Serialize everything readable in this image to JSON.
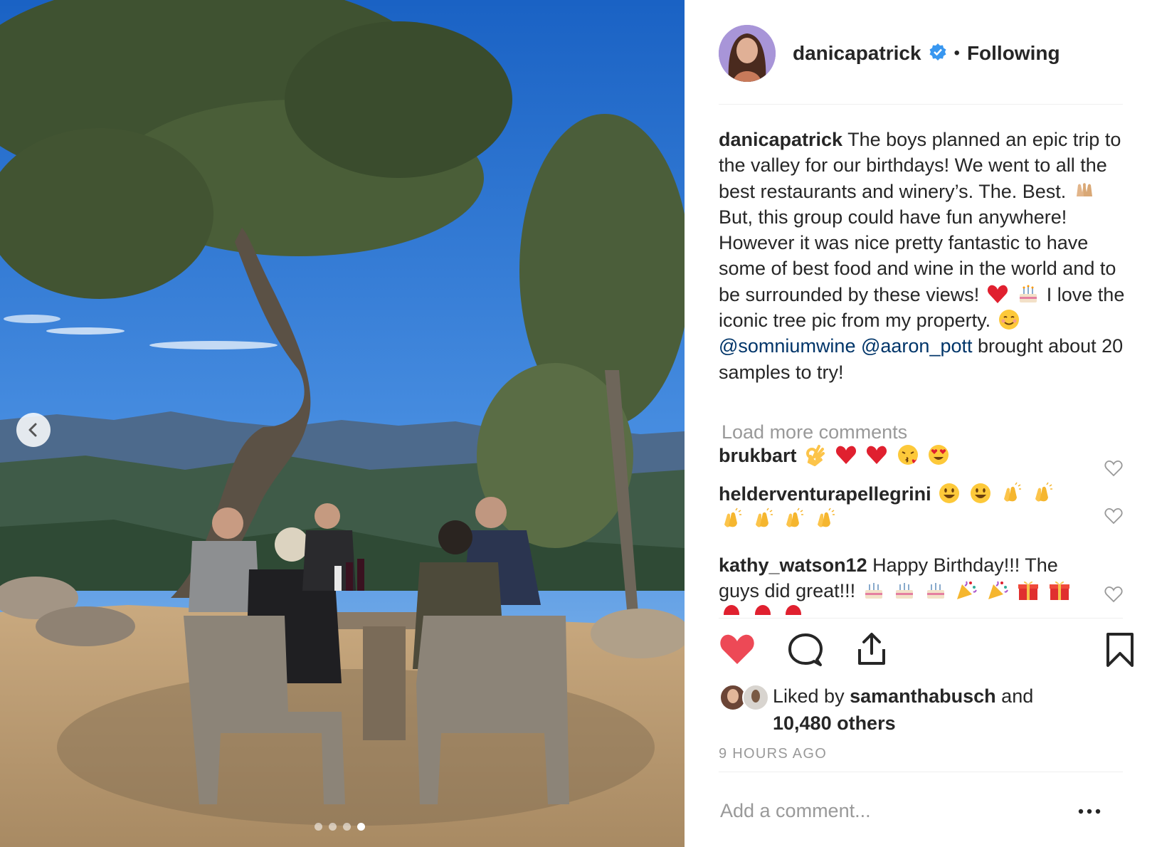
{
  "post": {
    "username": "danicapatrick",
    "separator": "•",
    "follow_status": "Following",
    "caption": {
      "username": "danicapatrick",
      "part1": "The boys planned an epic trip to the valley for our birthdays! We went to all the best restaurants and winery’s. The. Best.",
      "part2": "But, this group could have fun anywhere! However it was nice pretty fantastic to have some of best food and wine in the world and to be surrounded by these views!",
      "part3": "I love the iconic tree pic from my property.",
      "mention1": "@somniumwine",
      "mention2": "@aaron_pott",
      "part4": "brought about 20 samples to try!"
    },
    "load_more": "Load more comments",
    "comments": [
      {
        "user": "brukbart",
        "text": ""
      },
      {
        "user": "helderventurapellegrini",
        "text": ""
      },
      {
        "user": "kathy_watson12",
        "text": "Happy Birthday!!! The guys did great!!!"
      }
    ],
    "liked_by_prefix": "Liked by",
    "liked_by_user": "samanthabusch",
    "liked_by_and": "and",
    "liked_by_others": "10,480 others",
    "timestamp": "9 HOURS AGO",
    "add_comment_placeholder": "Add a comment...",
    "carousel": {
      "count": 4,
      "active": 4
    },
    "colors": {
      "like_red": "#ed4956",
      "mention_blue": "#003569",
      "muted": "#999999",
      "verified_blue": "#3897f0"
    }
  }
}
